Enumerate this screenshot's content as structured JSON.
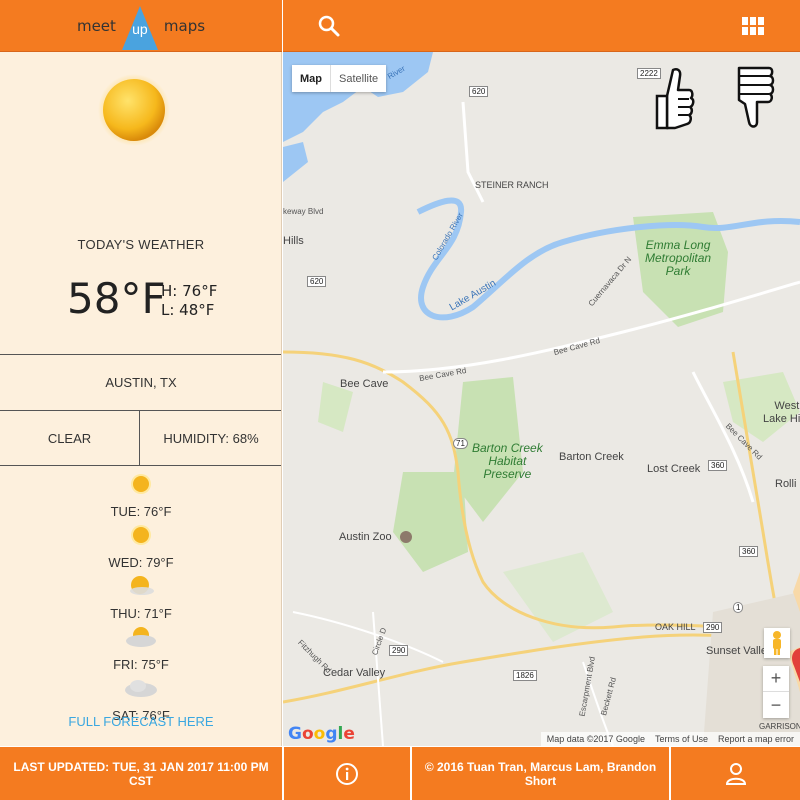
{
  "brand": {
    "word_left": "meet",
    "word_mid": "up",
    "word_right": "maps"
  },
  "colors": {
    "accent": "#f47b20",
    "sidebar_bg": "#fdf0dd",
    "link": "#3aa7e0",
    "park": "#2f7c33"
  },
  "weather": {
    "heading": "TODAY'S WEATHER",
    "temp": "58°F",
    "high": "H: 76°F",
    "low": "L: 48°F",
    "city": "AUSTIN, TX",
    "condition": "CLEAR",
    "humidity": "HUMIDITY: 68%",
    "forecast": [
      {
        "label": "TUE: 76°F",
        "icon": "sun-icon"
      },
      {
        "label": "WED: 79°F",
        "icon": "sun-icon"
      },
      {
        "label": "THU: 71°F",
        "icon": "partly-cloudy-icon"
      },
      {
        "label": "FRI: 75°F",
        "icon": "partly-cloudy-icon"
      },
      {
        "label": "SAT: 76°F",
        "icon": "cloud-icon"
      }
    ],
    "full_forecast": "FULL FORECAST HERE"
  },
  "map": {
    "type_buttons": [
      "Map",
      "Satellite"
    ],
    "labels": {
      "steiner": "STEINER RANCH",
      "emma": "Emma Long\nMetropolitan\nPark",
      "lake_austin": "Lake Austin",
      "colorado": "Colorado River",
      "bee_cave": "Bee Cave",
      "barton_preserve": "Barton Creek\nHabitat\nPreserve",
      "barton_creek": "Barton Creek",
      "lost_creek": "Lost Creek",
      "west_lake": "West\nLake Hills",
      "rollingwood": "Rolli",
      "austin_zoo": "Austin Zoo",
      "cedar_valley": "Cedar Valley",
      "oak_hill": "OAK HILL",
      "sunset_valley": "Sunset Valle",
      "garrison": "GARRISON P",
      "bee_cave_rd": "Bee Cave Rd",
      "bee_cave_rd2": "Bee Cave Rd",
      "bee_cave_rd3": "Bee Cave Rd",
      "cuernavaca": "Cuernavaca Dr N",
      "fitzhugh": "Fitzhugh Rd",
      "circle_d": "Circle D",
      "escarpment": "Escarpment Blvd",
      "beckett": "Beckett Rd",
      "keway": "keway Blvd",
      "hills": "Hills",
      "river": "River"
    },
    "shields": [
      "2222",
      "620",
      "620",
      "71",
      "360",
      "360",
      "290",
      "290",
      "1826",
      "1"
    ],
    "attribution": [
      "Map data ©2017 Google",
      "Terms of Use",
      "Report a map error"
    ],
    "google": "Google",
    "zoom_in": "+",
    "zoom_out": "−"
  },
  "footer": {
    "last_updated": "LAST UPDATED: TUE, 31 JAN 2017 11:00 PM CST",
    "copyright": "© 2016 Tuan Tran, Marcus Lam, Brandon Short"
  }
}
